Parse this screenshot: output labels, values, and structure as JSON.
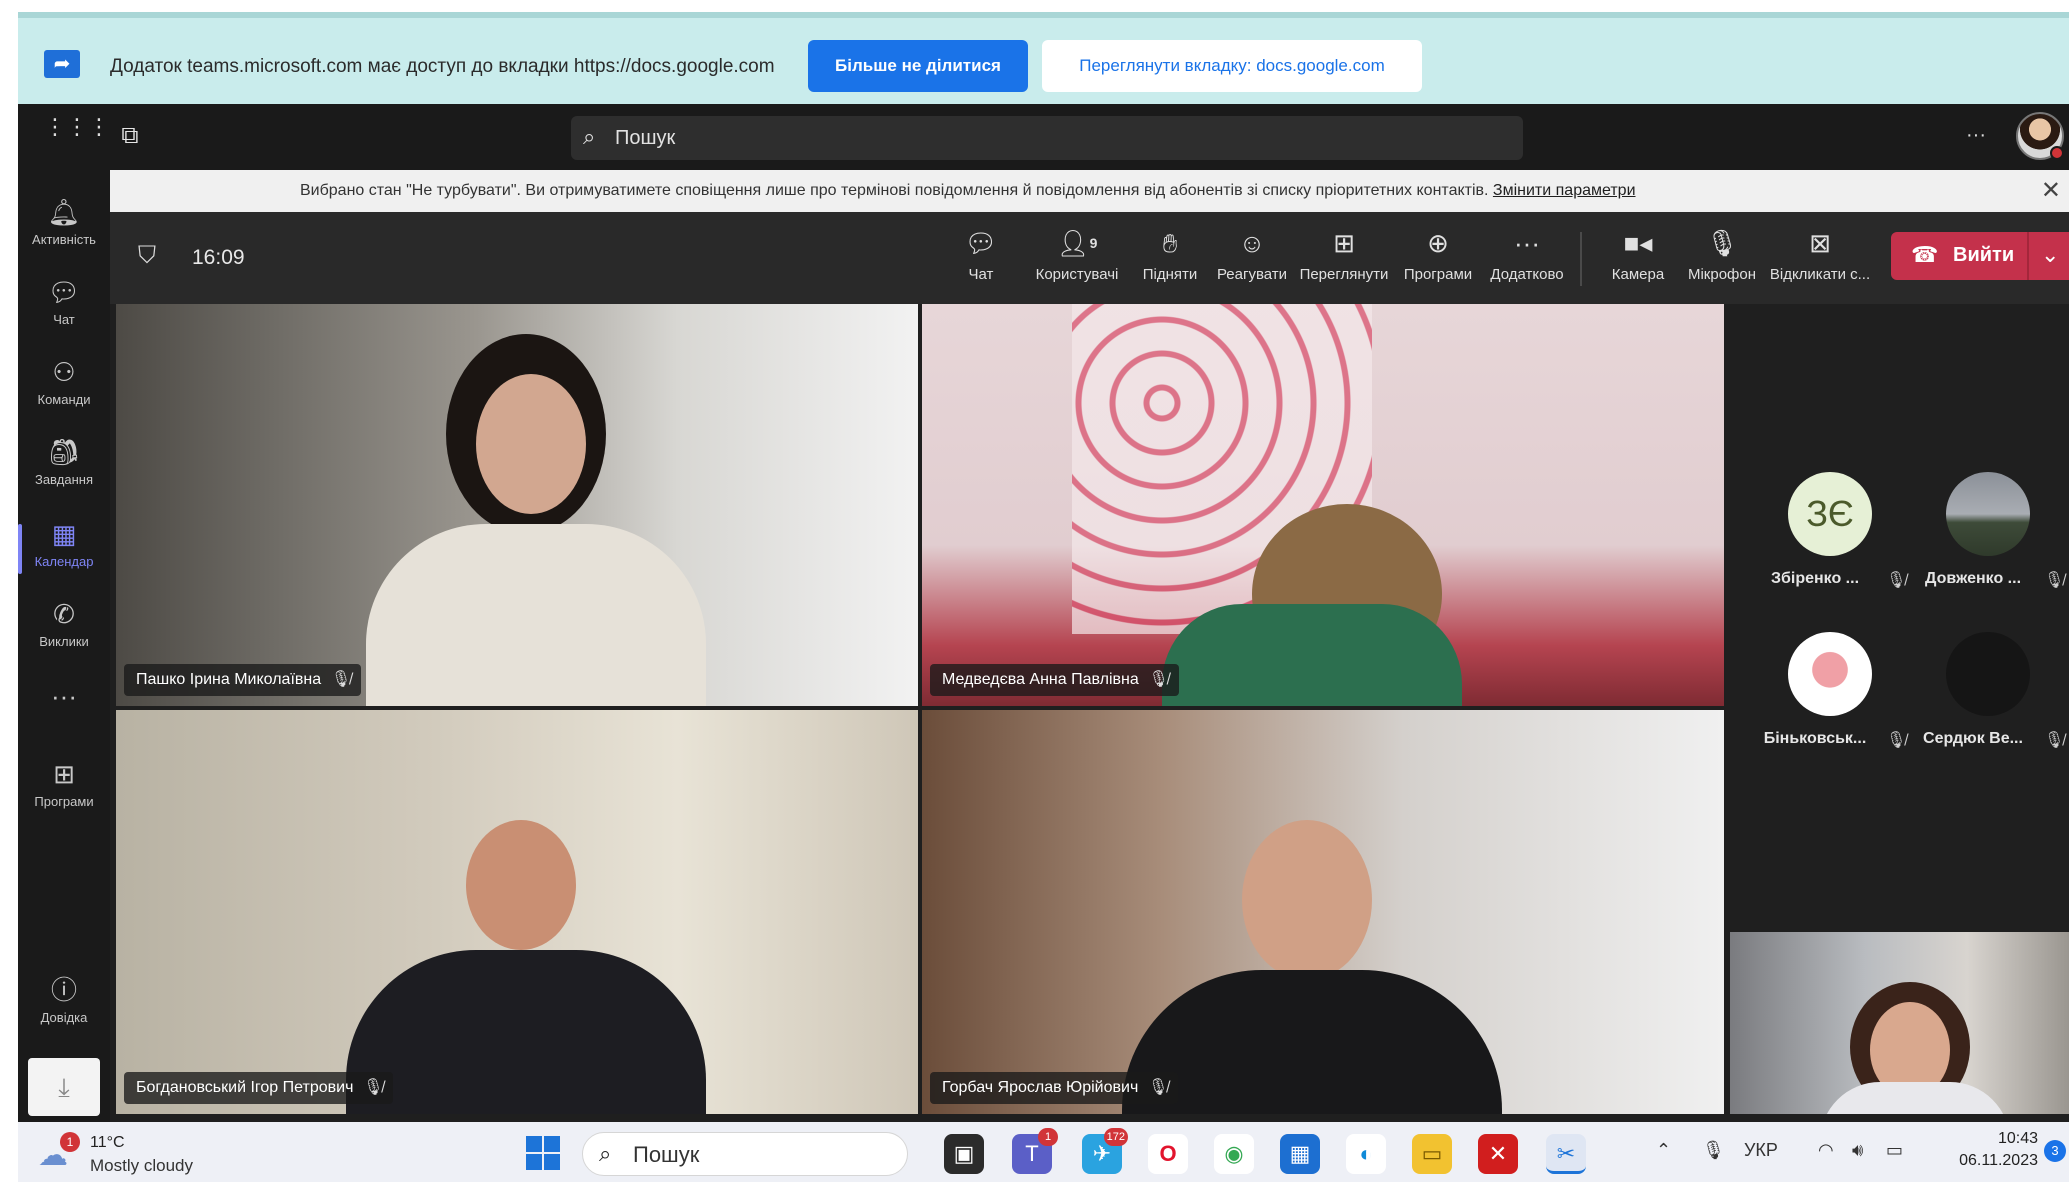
{
  "share_bar": {
    "message": "Додаток teams.microsoft.com має доступ до вкладки https://docs.google.com",
    "stop_label": "Більше не ділитися",
    "view_label": "Переглянути вкладку: docs.google.com"
  },
  "top_bar": {
    "search_placeholder": "Пошук"
  },
  "rail": {
    "items": [
      {
        "label": "Активність",
        "icon": "bell-icon"
      },
      {
        "label": "Чат",
        "icon": "chat-icon"
      },
      {
        "label": "Команди",
        "icon": "teams-group-icon"
      },
      {
        "label": "Завдання",
        "icon": "tasks-icon"
      },
      {
        "label": "Календар",
        "icon": "calendar-icon"
      },
      {
        "label": "Виклики",
        "icon": "phone-icon"
      },
      {
        "label": "Програми",
        "icon": "apps-grid-icon"
      },
      {
        "label": "Довідка",
        "icon": "help-icon"
      }
    ]
  },
  "notification": {
    "text": "Вибрано стан \"Не турбувати\". Ви отримуватимете сповіщення лише про термінові повідомлення й повідомлення від абонентів зі списку пріоритетних контактів.",
    "link": "Змінити параметри"
  },
  "meeting": {
    "time": "16:09",
    "participant_count": "9",
    "tools": {
      "chat": "Чат",
      "people": "Користувачі",
      "raise": "Підняти",
      "react": "Реагувати",
      "view": "Переглянути",
      "apps": "Програми",
      "more": "Додатково",
      "camera": "Камера",
      "mic": "Мікрофон",
      "share": "Відкликати с..."
    },
    "leave_label": "Вийти",
    "accent_color": "#c4314b"
  },
  "tiles": [
    {
      "name": "Пашко Ірина Миколаївна"
    },
    {
      "name": "Медведєва Анна Павлівна"
    },
    {
      "name": "Богдановський Ігор Петрович"
    },
    {
      "name": "Горбач Ярослав Юрійович"
    }
  ],
  "roster": [
    {
      "initials": "ЗЄ",
      "name": "Збіренко ..."
    },
    {
      "name": "Довженко ..."
    },
    {
      "name": "Біньковськ..."
    },
    {
      "name": "Сердюк Ве..."
    }
  ],
  "taskbar": {
    "weather_badge": "1",
    "temperature": "11°C",
    "weather_desc": "Mostly cloudy",
    "search_placeholder": "Пошук",
    "teams_badge": "1",
    "telegram_badge": "172",
    "language": "УКР",
    "time": "10:43",
    "date": "06.11.2023",
    "notifications": "3"
  }
}
